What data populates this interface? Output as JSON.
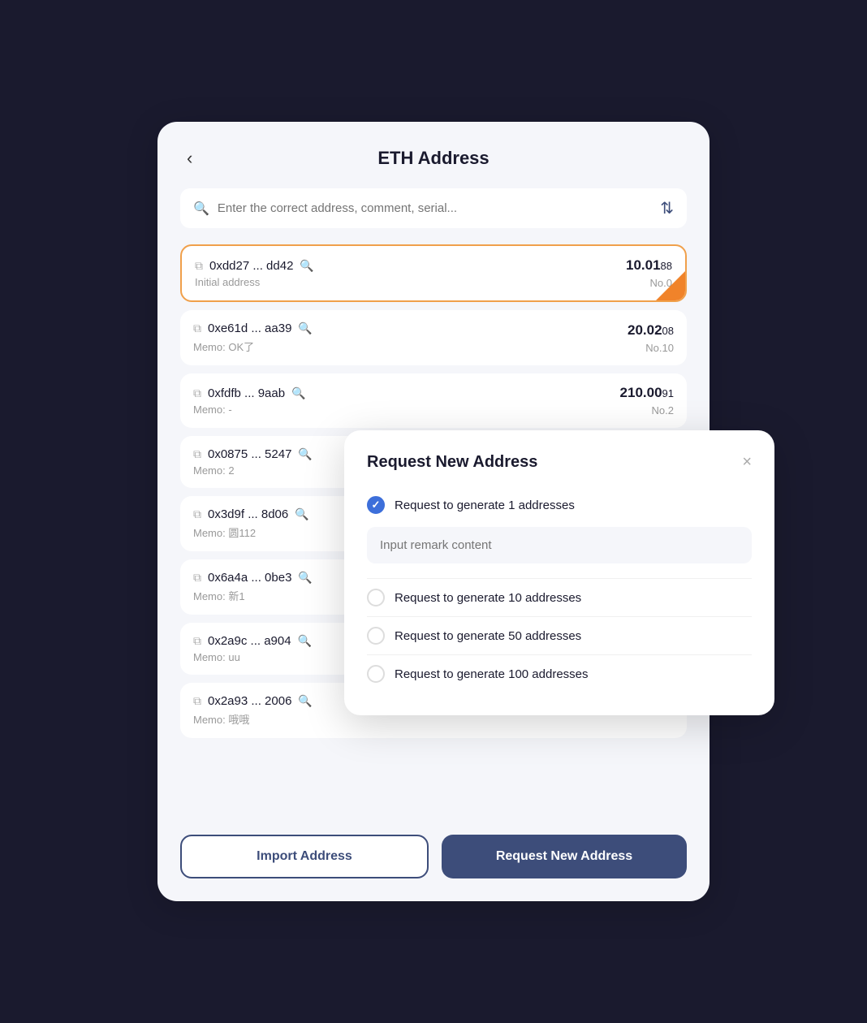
{
  "header": {
    "title": "ETH Address",
    "back_label": "‹"
  },
  "search": {
    "placeholder": "Enter the correct address, comment, serial..."
  },
  "addresses": [
    {
      "address": "0xdd27 ... dd42",
      "memo": "Initial address",
      "amount_main": "10.01",
      "amount_small": "88",
      "no": "No.0",
      "first": true
    },
    {
      "address": "0xe61d ... aa39",
      "memo": "Memo: OK了",
      "amount_main": "20.02",
      "amount_small": "08",
      "no": "No.10",
      "first": false
    },
    {
      "address": "0xfdfb ... 9aab",
      "memo": "Memo: -",
      "amount_main": "210.00",
      "amount_small": "91",
      "no": "No.2",
      "first": false
    },
    {
      "address": "0x0875 ... 5247",
      "memo": "Memo: 2",
      "amount_main": "",
      "amount_small": "",
      "no": "",
      "first": false
    },
    {
      "address": "0x3d9f ... 8d06",
      "memo": "Memo: 圆112",
      "amount_main": "",
      "amount_small": "",
      "no": "",
      "first": false
    },
    {
      "address": "0x6a4a ... 0be3",
      "memo": "Memo: 新1",
      "amount_main": "",
      "amount_small": "",
      "no": "",
      "first": false
    },
    {
      "address": "0x2a9c ... a904",
      "memo": "Memo: uu",
      "amount_main": "",
      "amount_small": "",
      "no": "",
      "first": false
    },
    {
      "address": "0x2a93 ... 2006",
      "memo": "Memo: 哦哦",
      "amount_main": "",
      "amount_small": "",
      "no": "",
      "first": false
    }
  ],
  "buttons": {
    "import": "Import Address",
    "request": "Request New Address"
  },
  "modal": {
    "title": "Request New Address",
    "close_icon": "×",
    "remark_placeholder": "Input remark content",
    "options": [
      {
        "label": "Request to generate 1 addresses",
        "checked": true
      },
      {
        "label": "Request to generate 10 addresses",
        "checked": false
      },
      {
        "label": "Request to generate 50 addresses",
        "checked": false
      },
      {
        "label": "Request to generate 100 addresses",
        "checked": false
      }
    ]
  }
}
